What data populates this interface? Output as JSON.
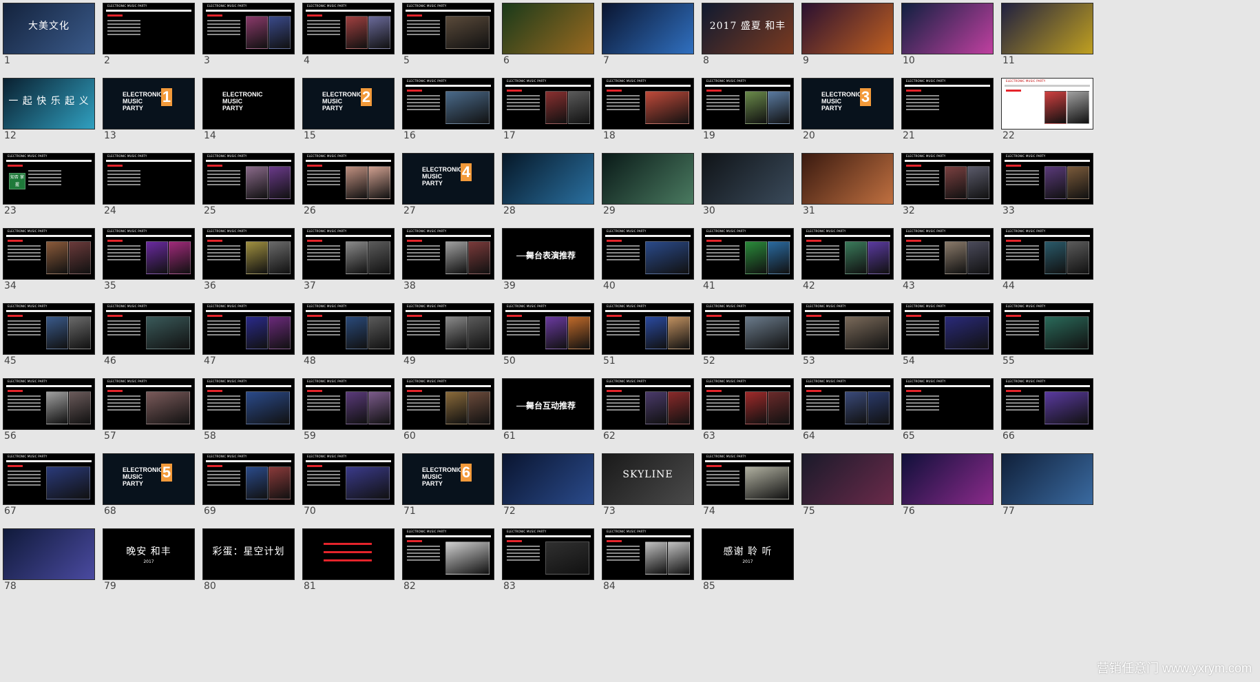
{
  "accent": "#e5242b",
  "chapter_color": "#f39a3a",
  "caption_text": "ELECTRONIC MUSIC PARTY",
  "chapter_text": "ELECTRONIC MUSIC PARTY",
  "watermark": "营销任意门 www.yxrym.com",
  "slides": [
    {
      "n": "1",
      "kind": "hero",
      "title": "大美文化",
      "bg": "#14233d",
      "bg2": "#3a5a8a"
    },
    {
      "n": "2",
      "kind": "text",
      "bg": "#000000"
    },
    {
      "n": "3",
      "kind": "photo",
      "bg": "#000000",
      "photos": [
        "#8a3a6a",
        "#3a4a8a"
      ]
    },
    {
      "n": "4",
      "kind": "photo",
      "bg": "#000000",
      "photos": [
        "#a04040",
        "#6a6a9a"
      ]
    },
    {
      "n": "5",
      "kind": "photo",
      "bg": "#000000",
      "photos": [
        "#5a4a3a"
      ]
    },
    {
      "n": "6",
      "kind": "hero",
      "title": "",
      "bg": "#1a3a1a",
      "bg2": "#9a6a20"
    },
    {
      "n": "7",
      "kind": "hero",
      "title": "",
      "bg": "#0a1530",
      "bg2": "#3070c0"
    },
    {
      "n": "8",
      "kind": "hero",
      "title": "2017 盛夏 和丰",
      "bg": "#101a30",
      "bg2": "#7a3a20"
    },
    {
      "n": "9",
      "kind": "hero",
      "title": "",
      "bg": "#2a1030",
      "bg2": "#c06020"
    },
    {
      "n": "10",
      "kind": "hero",
      "title": "",
      "bg": "#102040",
      "bg2": "#c040a0"
    },
    {
      "n": "11",
      "kind": "hero",
      "title": "",
      "bg": "#202040",
      "bg2": "#c0a020"
    },
    {
      "n": "12",
      "kind": "hero",
      "title": "一 起 快 乐 起 义",
      "bg": "#0a2030",
      "bg2": "#30a0c0"
    },
    {
      "n": "13",
      "kind": "chapter",
      "num": "1",
      "bg": "#08121c"
    },
    {
      "n": "14",
      "kind": "chapter",
      "num": "",
      "bg": "#000000"
    },
    {
      "n": "15",
      "kind": "chapter",
      "num": "2",
      "bg": "#08121c"
    },
    {
      "n": "16",
      "kind": "photo",
      "bg": "#000000",
      "photos": [
        "#4a6a8a"
      ]
    },
    {
      "n": "17",
      "kind": "photo",
      "bg": "#000000",
      "photos": [
        "#8a3030",
        "#5a5a5a"
      ]
    },
    {
      "n": "18",
      "kind": "photo",
      "bg": "#000000",
      "photos": [
        "#c04a3a"
      ]
    },
    {
      "n": "19",
      "kind": "photo",
      "bg": "#000000",
      "photos": [
        "#6a8a4a",
        "#5a7aa0"
      ]
    },
    {
      "n": "20",
      "kind": "chapter",
      "num": "3",
      "bg": "#08121c"
    },
    {
      "n": "21",
      "kind": "text",
      "bg": "#000000"
    },
    {
      "n": "22",
      "kind": "photo",
      "bg": "#ffffff",
      "photos": [
        "#d04040",
        "#a0a0a0"
      ]
    },
    {
      "n": "23",
      "kind": "text",
      "bg": "#000000",
      "badge": "知否 掌握"
    },
    {
      "n": "24",
      "kind": "text",
      "bg": "#000000"
    },
    {
      "n": "25",
      "kind": "photo",
      "bg": "#000000",
      "photos": [
        "#8a6a8a",
        "#6a3a8a"
      ]
    },
    {
      "n": "26",
      "kind": "photo",
      "bg": "#000000",
      "photos": [
        "#c09080",
        "#d0a090"
      ]
    },
    {
      "n": "27",
      "kind": "chapter",
      "num": "4",
      "bg": "#08121c"
    },
    {
      "n": "28",
      "kind": "hero",
      "title": "",
      "bg": "#061828",
      "bg2": "#2a70a0"
    },
    {
      "n": "29",
      "kind": "hero",
      "title": "",
      "bg": "#0a1a18",
      "bg2": "#4a7a60"
    },
    {
      "n": "30",
      "kind": "hero",
      "title": "",
      "bg": "#101418",
      "bg2": "#3a4a5a"
    },
    {
      "n": "31",
      "kind": "hero",
      "title": "",
      "bg": "#3a1a10",
      "bg2": "#c07040"
    },
    {
      "n": "32",
      "kind": "photo",
      "bg": "#000000",
      "photos": [
        "#7a4040",
        "#5a5a6a"
      ]
    },
    {
      "n": "33",
      "kind": "photo",
      "bg": "#000000",
      "photos": [
        "#5a3a7a",
        "#7a5a3a"
      ]
    },
    {
      "n": "34",
      "kind": "photo",
      "bg": "#000000",
      "photos": [
        "#8a5a3a",
        "#6a3a3a"
      ]
    },
    {
      "n": "35",
      "kind": "photo",
      "bg": "#000000",
      "photos": [
        "#6a2aa0",
        "#a02a7a"
      ]
    },
    {
      "n": "36",
      "kind": "photo",
      "bg": "#000000",
      "photos": [
        "#a09040",
        "#6a6a6a"
      ]
    },
    {
      "n": "37",
      "kind": "photo",
      "bg": "#000000",
      "photos": [
        "#8a8a8a",
        "#5a5a5a"
      ]
    },
    {
      "n": "38",
      "kind": "photo",
      "bg": "#000000",
      "photos": [
        "#a0a0a0",
        "#7a3a3a"
      ]
    },
    {
      "n": "39",
      "kind": "line",
      "title": "舞台表演推荐",
      "bg": "#000000"
    },
    {
      "n": "40",
      "kind": "photo",
      "bg": "#000000",
      "photos": [
        "#2a4a8a"
      ]
    },
    {
      "n": "41",
      "kind": "photo",
      "bg": "#000000",
      "photos": [
        "#2a8a3a",
        "#2a6aa0"
      ]
    },
    {
      "n": "42",
      "kind": "photo",
      "bg": "#000000",
      "photos": [
        "#3a7a5a",
        "#5a3aa0"
      ]
    },
    {
      "n": "43",
      "kind": "photo",
      "bg": "#000000",
      "photos": [
        "#8a7a6a",
        "#4a4a5a"
      ]
    },
    {
      "n": "44",
      "kind": "photo",
      "bg": "#000000",
      "photos": [
        "#2a5a6a",
        "#5a5a5a"
      ]
    },
    {
      "n": "45",
      "kind": "photo",
      "bg": "#000000",
      "photos": [
        "#3a5a8a",
        "#6a6a6a"
      ]
    },
    {
      "n": "46",
      "kind": "photo",
      "bg": "#000000",
      "photos": [
        "#3a5a5a"
      ]
    },
    {
      "n": "47",
      "kind": "photo",
      "bg": "#000000",
      "photos": [
        "#2a2a8a",
        "#6a2a7a"
      ]
    },
    {
      "n": "48",
      "kind": "photo",
      "bg": "#000000",
      "photos": [
        "#2a4a7a",
        "#5a5a5a"
      ]
    },
    {
      "n": "49",
      "kind": "photo",
      "bg": "#000000",
      "photos": [
        "#8a8a8a",
        "#5a5a5a"
      ]
    },
    {
      "n": "50",
      "kind": "photo",
      "bg": "#000000",
      "photos": [
        "#6a3aa0",
        "#c06a2a"
      ]
    },
    {
      "n": "51",
      "kind": "photo",
      "bg": "#000000",
      "photos": [
        "#2a4aa0",
        "#c09060"
      ]
    },
    {
      "n": "52",
      "kind": "photo",
      "bg": "#000000",
      "photos": [
        "#6a7a8a"
      ]
    },
    {
      "n": "53",
      "kind": "photo",
      "bg": "#000000",
      "photos": [
        "#7a6a5a"
      ]
    },
    {
      "n": "54",
      "kind": "photo",
      "bg": "#000000",
      "photos": [
        "#2a2a7a"
      ]
    },
    {
      "n": "55",
      "kind": "photo",
      "bg": "#000000",
      "photos": [
        "#2a6a5a"
      ]
    },
    {
      "n": "56",
      "kind": "photo",
      "bg": "#000000",
      "photos": [
        "#a0a0a0",
        "#6a5a5a"
      ]
    },
    {
      "n": "57",
      "kind": "photo",
      "bg": "#000000",
      "photos": [
        "#7a5a5a"
      ]
    },
    {
      "n": "58",
      "kind": "photo",
      "bg": "#000000",
      "photos": [
        "#2a4a8a"
      ]
    },
    {
      "n": "59",
      "kind": "photo",
      "bg": "#000000",
      "photos": [
        "#5a3a7a",
        "#7a5a8a"
      ]
    },
    {
      "n": "60",
      "kind": "photo",
      "bg": "#000000",
      "photos": [
        "#8a6a3a",
        "#6a4a3a"
      ]
    },
    {
      "n": "61",
      "kind": "line",
      "title": "舞台互动推荐",
      "bg": "#000000"
    },
    {
      "n": "62",
      "kind": "photo",
      "bg": "#000000",
      "photos": [
        "#4a3a6a",
        "#8a2a2a"
      ]
    },
    {
      "n": "63",
      "kind": "photo",
      "bg": "#000000",
      "photos": [
        "#a02a2a",
        "#6a2a2a"
      ]
    },
    {
      "n": "64",
      "kind": "photo",
      "bg": "#000000",
      "photos": [
        "#3a4a7a",
        "#2a3a6a"
      ]
    },
    {
      "n": "65",
      "kind": "text",
      "bg": "#000000"
    },
    {
      "n": "66",
      "kind": "photo",
      "bg": "#000000",
      "photos": [
        "#5a3aa0"
      ]
    },
    {
      "n": "67",
      "kind": "photo",
      "bg": "#000000",
      "photos": [
        "#2a3a7a"
      ]
    },
    {
      "n": "68",
      "kind": "chapter",
      "num": "5",
      "bg": "#08121c"
    },
    {
      "n": "69",
      "kind": "photo",
      "bg": "#000000",
      "photos": [
        "#2a4a8a",
        "#8a3a3a"
      ]
    },
    {
      "n": "70",
      "kind": "photo",
      "bg": "#000000",
      "photos": [
        "#3a3a8a"
      ]
    },
    {
      "n": "71",
      "kind": "chapter",
      "num": "6",
      "bg": "#08121c"
    },
    {
      "n": "72",
      "kind": "hero",
      "title": "",
      "bg": "#0a1530",
      "bg2": "#2a4a8a"
    },
    {
      "n": "73",
      "kind": "hero",
      "title": "SKYLINE",
      "bg": "#1a1a1a",
      "bg2": "#4a4a4a"
    },
    {
      "n": "74",
      "kind": "photo",
      "bg": "#000000",
      "photos": [
        "#b0b0a0"
      ]
    },
    {
      "n": "75",
      "kind": "hero",
      "title": "",
      "bg": "#1a1a2a",
      "bg2": "#6a2a4a"
    },
    {
      "n": "76",
      "kind": "hero",
      "title": "",
      "bg": "#10103a",
      "bg2": "#8a2a8a"
    },
    {
      "n": "77",
      "kind": "hero",
      "title": "",
      "bg": "#10203a",
      "bg2": "#3a6aa0"
    },
    {
      "n": "78",
      "kind": "hero",
      "title": "",
      "bg": "#101a3a",
      "bg2": "#4a4aa0"
    },
    {
      "n": "79",
      "kind": "closing",
      "title": "晚安 和丰",
      "sub": "2017",
      "bg": "#000000"
    },
    {
      "n": "80",
      "kind": "closing",
      "title": "彩蛋：星空计划",
      "sub": "",
      "bg": "#000000"
    },
    {
      "n": "81",
      "kind": "closing",
      "title": "",
      "sub": "",
      "bg": "#000000",
      "red": true
    },
    {
      "n": "82",
      "kind": "photo",
      "bg": "#000000",
      "photos": [
        "#d0d0d0"
      ]
    },
    {
      "n": "83",
      "kind": "photo",
      "bg": "#000000",
      "photos": [
        "#303030"
      ]
    },
    {
      "n": "84",
      "kind": "photo",
      "bg": "#000000",
      "photos": [
        "#c0c0c0",
        "#c0c0c0"
      ]
    },
    {
      "n": "85",
      "kind": "closing",
      "title": "感谢 聆 听",
      "sub": "2017",
      "bg": "#000000"
    }
  ]
}
